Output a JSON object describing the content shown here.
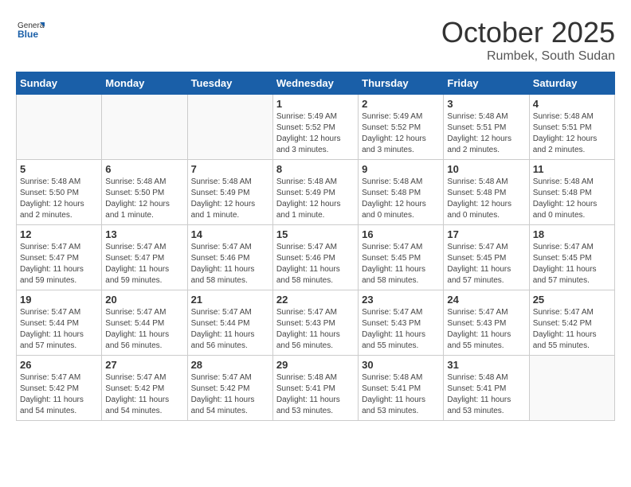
{
  "logo": {
    "general": "General",
    "blue": "Blue"
  },
  "title": "October 2025",
  "location": "Rumbek, South Sudan",
  "days_of_week": [
    "Sunday",
    "Monday",
    "Tuesday",
    "Wednesday",
    "Thursday",
    "Friday",
    "Saturday"
  ],
  "weeks": [
    [
      {
        "day": "",
        "info": ""
      },
      {
        "day": "",
        "info": ""
      },
      {
        "day": "",
        "info": ""
      },
      {
        "day": "1",
        "info": "Sunrise: 5:49 AM\nSunset: 5:52 PM\nDaylight: 12 hours\nand 3 minutes."
      },
      {
        "day": "2",
        "info": "Sunrise: 5:49 AM\nSunset: 5:52 PM\nDaylight: 12 hours\nand 3 minutes."
      },
      {
        "day": "3",
        "info": "Sunrise: 5:48 AM\nSunset: 5:51 PM\nDaylight: 12 hours\nand 2 minutes."
      },
      {
        "day": "4",
        "info": "Sunrise: 5:48 AM\nSunset: 5:51 PM\nDaylight: 12 hours\nand 2 minutes."
      }
    ],
    [
      {
        "day": "5",
        "info": "Sunrise: 5:48 AM\nSunset: 5:50 PM\nDaylight: 12 hours\nand 2 minutes."
      },
      {
        "day": "6",
        "info": "Sunrise: 5:48 AM\nSunset: 5:50 PM\nDaylight: 12 hours\nand 1 minute."
      },
      {
        "day": "7",
        "info": "Sunrise: 5:48 AM\nSunset: 5:49 PM\nDaylight: 12 hours\nand 1 minute."
      },
      {
        "day": "8",
        "info": "Sunrise: 5:48 AM\nSunset: 5:49 PM\nDaylight: 12 hours\nand 1 minute."
      },
      {
        "day": "9",
        "info": "Sunrise: 5:48 AM\nSunset: 5:48 PM\nDaylight: 12 hours\nand 0 minutes."
      },
      {
        "day": "10",
        "info": "Sunrise: 5:48 AM\nSunset: 5:48 PM\nDaylight: 12 hours\nand 0 minutes."
      },
      {
        "day": "11",
        "info": "Sunrise: 5:48 AM\nSunset: 5:48 PM\nDaylight: 12 hours\nand 0 minutes."
      }
    ],
    [
      {
        "day": "12",
        "info": "Sunrise: 5:47 AM\nSunset: 5:47 PM\nDaylight: 11 hours\nand 59 minutes."
      },
      {
        "day": "13",
        "info": "Sunrise: 5:47 AM\nSunset: 5:47 PM\nDaylight: 11 hours\nand 59 minutes."
      },
      {
        "day": "14",
        "info": "Sunrise: 5:47 AM\nSunset: 5:46 PM\nDaylight: 11 hours\nand 58 minutes."
      },
      {
        "day": "15",
        "info": "Sunrise: 5:47 AM\nSunset: 5:46 PM\nDaylight: 11 hours\nand 58 minutes."
      },
      {
        "day": "16",
        "info": "Sunrise: 5:47 AM\nSunset: 5:45 PM\nDaylight: 11 hours\nand 58 minutes."
      },
      {
        "day": "17",
        "info": "Sunrise: 5:47 AM\nSunset: 5:45 PM\nDaylight: 11 hours\nand 57 minutes."
      },
      {
        "day": "18",
        "info": "Sunrise: 5:47 AM\nSunset: 5:45 PM\nDaylight: 11 hours\nand 57 minutes."
      }
    ],
    [
      {
        "day": "19",
        "info": "Sunrise: 5:47 AM\nSunset: 5:44 PM\nDaylight: 11 hours\nand 57 minutes."
      },
      {
        "day": "20",
        "info": "Sunrise: 5:47 AM\nSunset: 5:44 PM\nDaylight: 11 hours\nand 56 minutes."
      },
      {
        "day": "21",
        "info": "Sunrise: 5:47 AM\nSunset: 5:44 PM\nDaylight: 11 hours\nand 56 minutes."
      },
      {
        "day": "22",
        "info": "Sunrise: 5:47 AM\nSunset: 5:43 PM\nDaylight: 11 hours\nand 56 minutes."
      },
      {
        "day": "23",
        "info": "Sunrise: 5:47 AM\nSunset: 5:43 PM\nDaylight: 11 hours\nand 55 minutes."
      },
      {
        "day": "24",
        "info": "Sunrise: 5:47 AM\nSunset: 5:43 PM\nDaylight: 11 hours\nand 55 minutes."
      },
      {
        "day": "25",
        "info": "Sunrise: 5:47 AM\nSunset: 5:42 PM\nDaylight: 11 hours\nand 55 minutes."
      }
    ],
    [
      {
        "day": "26",
        "info": "Sunrise: 5:47 AM\nSunset: 5:42 PM\nDaylight: 11 hours\nand 54 minutes."
      },
      {
        "day": "27",
        "info": "Sunrise: 5:47 AM\nSunset: 5:42 PM\nDaylight: 11 hours\nand 54 minutes."
      },
      {
        "day": "28",
        "info": "Sunrise: 5:47 AM\nSunset: 5:42 PM\nDaylight: 11 hours\nand 54 minutes."
      },
      {
        "day": "29",
        "info": "Sunrise: 5:48 AM\nSunset: 5:41 PM\nDaylight: 11 hours\nand 53 minutes."
      },
      {
        "day": "30",
        "info": "Sunrise: 5:48 AM\nSunset: 5:41 PM\nDaylight: 11 hours\nand 53 minutes."
      },
      {
        "day": "31",
        "info": "Sunrise: 5:48 AM\nSunset: 5:41 PM\nDaylight: 11 hours\nand 53 minutes."
      },
      {
        "day": "",
        "info": ""
      }
    ]
  ]
}
